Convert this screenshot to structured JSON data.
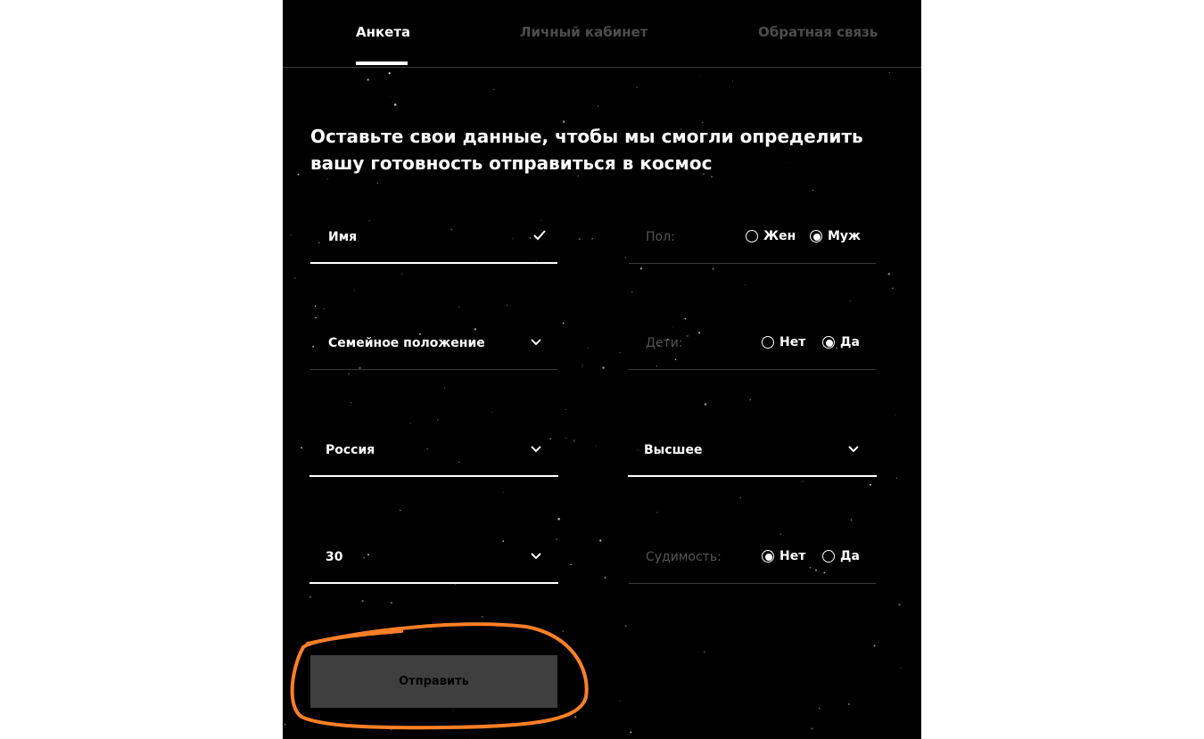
{
  "tabs": [
    {
      "label": "Анкета",
      "active": true
    },
    {
      "label": "Личный кабинет",
      "active": false
    },
    {
      "label": "Обратная связь",
      "active": false
    }
  ],
  "form": {
    "title": "Оставьте свои данные, чтобы мы смогли определить вашу готовность отправиться в космос",
    "name_field": {
      "value": "Имя",
      "icon": "check-icon"
    },
    "marital_select": {
      "value": "Семейное положение",
      "icon": "chevron-down-icon"
    },
    "country_select": {
      "value": "Россия",
      "icon": "chevron-down-icon"
    },
    "age_select": {
      "value": "30",
      "icon": "chevron-down-icon"
    },
    "education_select": {
      "value": "Высшее",
      "icon": "chevron-down-icon"
    },
    "gender": {
      "label": "Пол:",
      "options": [
        "Жен",
        "Муж"
      ],
      "selected": "Муж"
    },
    "children": {
      "label": "Дети:",
      "options": [
        "Нет",
        "Да"
      ],
      "selected": "Да"
    },
    "criminal_record": {
      "label": "Судимость:",
      "options": [
        "Нет",
        "Да"
      ],
      "selected": "Нет"
    },
    "submit_label": "Отправить"
  },
  "colors": {
    "background": "#000000",
    "text": "#ffffff",
    "muted": "#555555",
    "button": "#3f3f3f",
    "annotation": "#ff7f27"
  }
}
